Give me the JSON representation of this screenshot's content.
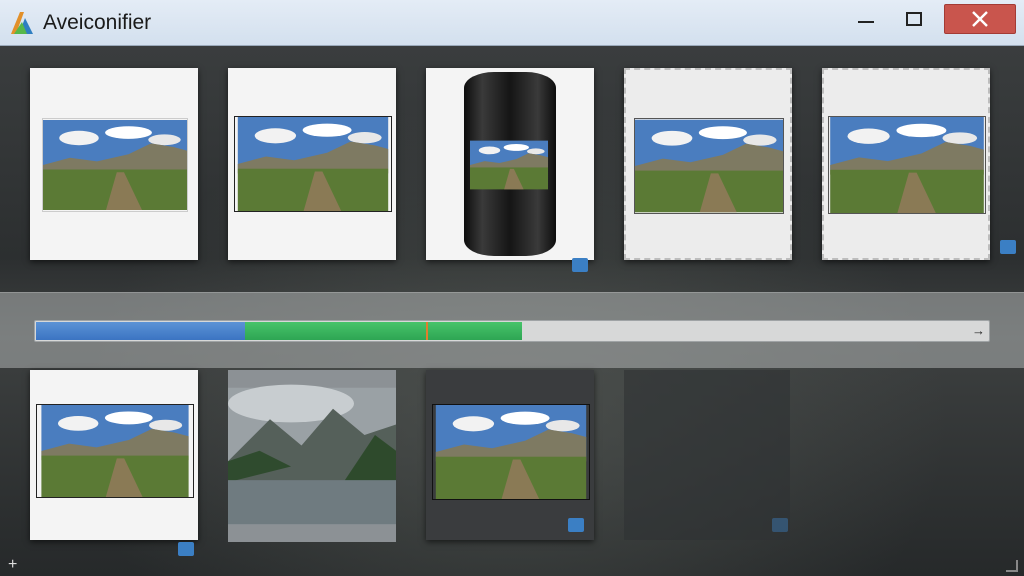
{
  "window": {
    "title": "Aveiconifier",
    "controls": {
      "minimize": "minimize",
      "maximize": "maximize",
      "close": "close"
    }
  },
  "icons": {
    "app": "app-logo-icon",
    "close": "close-icon",
    "arrow": "arrow-right-icon",
    "add": "plus-icon",
    "resize": "resize-grip-icon",
    "image_badge": "image-icon"
  },
  "thumbnails_row1": [
    {
      "style": "paper-border"
    },
    {
      "style": "paper-plain"
    },
    {
      "style": "cylinder"
    },
    {
      "style": "torn-edge"
    },
    {
      "style": "torn-edge"
    }
  ],
  "thumbnails_row2": [
    {
      "style": "paper-curled"
    },
    {
      "style": "mountain-lake"
    },
    {
      "style": "dark-frame"
    },
    {
      "style": "faded"
    }
  ],
  "progress": {
    "segments": [
      {
        "name": "blue",
        "fraction": 0.22,
        "color": "#3b74c2"
      },
      {
        "name": "green",
        "fraction": 0.29,
        "color": "#2ea553"
      }
    ],
    "marker_fraction": 0.41,
    "marker_color": "#e07d2c",
    "arrow": "→"
  },
  "colors": {
    "titlebar": "#d8e3ef",
    "close": "#c9554d",
    "accent_blue": "#3b74c2",
    "accent_green": "#2ea553"
  }
}
